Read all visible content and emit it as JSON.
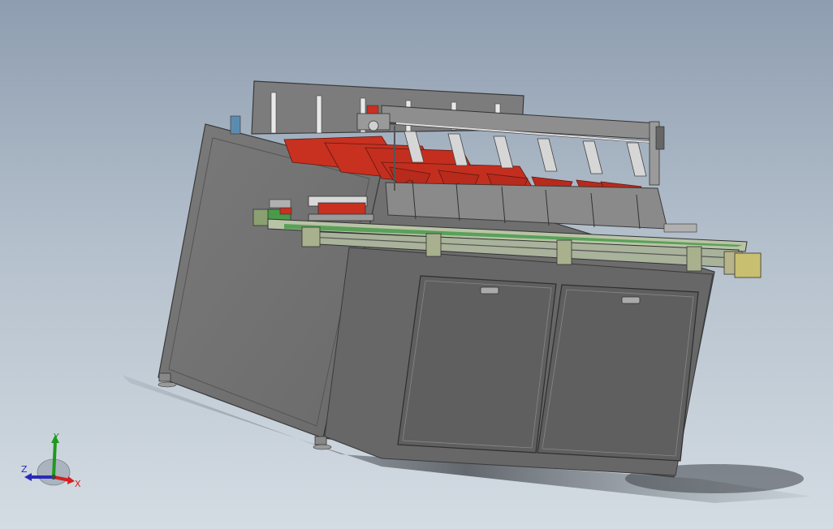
{
  "triad": {
    "x_label": "X",
    "y_label": "Y",
    "z_label": "Z",
    "x_color": "#d42020",
    "y_color": "#1e9a1e",
    "z_color": "#2a2ab8"
  },
  "colors": {
    "background_top": "#8e9db0",
    "background_bottom": "#d4dce3",
    "frame": "#6b6b6b",
    "trays": "#c83020",
    "conveyor_frame": "#9aa38a",
    "motor": "#c8c070"
  }
}
